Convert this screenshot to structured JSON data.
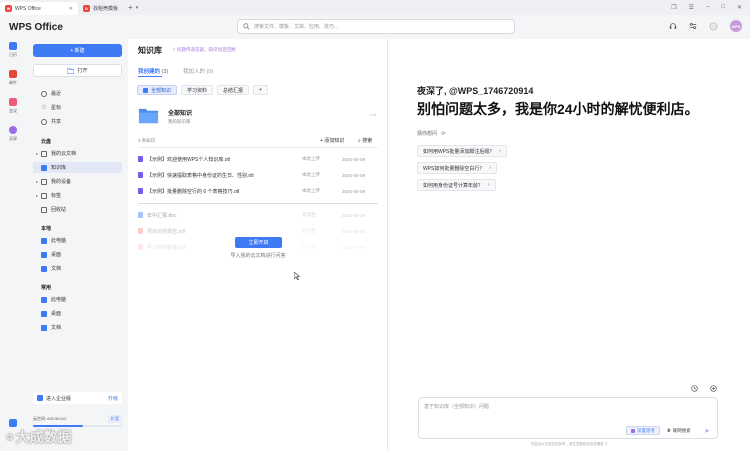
{
  "titlebar": {
    "tabs": [
      {
        "label": "WPS Office",
        "active": true
      },
      {
        "label": "找稻壳模板",
        "active": false
      }
    ]
  },
  "topbar": {
    "brand": "WPS Office",
    "search_placeholder": "搜索文件、模板、文库、应用、技巧...",
    "avatar_text": "WPS"
  },
  "rail": {
    "items": [
      "日历",
      "邮件",
      "会议",
      "灵犀"
    ]
  },
  "nav": {
    "new_label": "+ 新建",
    "open_label": "打开",
    "top_items": [
      "最近",
      "星标",
      "共享"
    ],
    "cloud_section": "云盘",
    "cloud_items": [
      "我的云文档",
      "知识库",
      "我的设备",
      "标签",
      "回收站"
    ],
    "local_section": "本地",
    "local_items": [
      "此电脑",
      "桌面",
      "文档"
    ],
    "common_section": "常用",
    "common_items": [
      "此电脑",
      "桌面",
      "文档"
    ],
    "enterprise_label": "进入企业版",
    "upgrade_label": "升级",
    "storage_label": "云空间: 690.5K/1G",
    "expand_label": "扩容",
    "storage_fraction": 0.56
  },
  "kb": {
    "title": "知识库",
    "hint": "问题传递答疑，知识创造回顾",
    "tab_created": "我创建的",
    "tab_created_count": "(3)",
    "tab_joined": "我加入的",
    "tab_joined_count": "(0)",
    "chips": [
      "全部知识",
      "学习资料",
      "总结汇报",
      "+"
    ],
    "all_title": "全部知识",
    "all_sub": "我的知识库",
    "count_label": "3 条知识",
    "add_label": "+ 添加知识",
    "search_label": "搜索",
    "rows": [
      {
        "name": "【示例】欢迎使用WPS个人知识库.otl",
        "src": "本地上传",
        "date": "2025-05-09"
      },
      {
        "name": "【示例】快速提取表格中身份证的生日、性别.otl",
        "src": "本地上传",
        "date": "2025-05-09"
      },
      {
        "name": "【示例】批量删除空行的 6 个表格技巧.otl",
        "src": "本地上传",
        "date": "2025-05-09"
      }
    ],
    "faded_rows": [
      {
        "name": "年中汇报.doc",
        "src": "云文档",
        "date": "2025-05-09"
      },
      {
        "name": "项目总结报告.pdf",
        "src": "云文档",
        "date": "2025-05-09"
      },
      {
        "name": "学习资料整理.pdf",
        "src": "云文档",
        "date": "2025-05-09"
      }
    ],
    "import_button": "立即开启",
    "import_hint": "导入我的云文档进行问答"
  },
  "chat": {
    "greeting": "夜深了, @WPS_1746720914",
    "slogan": "别怕问题太多，我是你24小时的解忧便利店。",
    "guess_label": "猜你想问",
    "suggestions": [
      "如何用WPS批量添加脚注后缀？",
      "WPS如何批量删除空白行？",
      "如何用身份证号计算年龄？"
    ],
    "input_placeholder": "基于知识库（全部知识）问题",
    "deep_think": "深度思考",
    "web_search": "联网搜索",
    "disclaimer": "内容由AI生成仅供参考，请注意甄别信息准确性 ©"
  },
  "watermark": "大成数据",
  "colors": {
    "accent": "#3f7af5",
    "sidebar_bg": "#f4f5f7",
    "hint_purple": "#a877d9"
  }
}
